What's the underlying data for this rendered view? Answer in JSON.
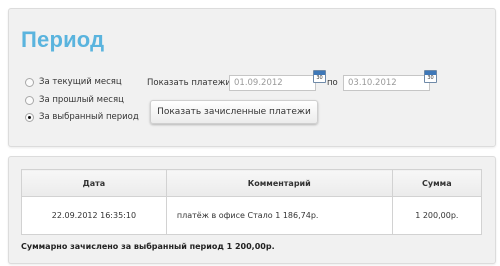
{
  "page": {
    "title": "Период"
  },
  "period_options": [
    {
      "label": "За текущий месяц",
      "checked": false
    },
    {
      "label": "За прошлый месяц",
      "checked": false
    },
    {
      "label": "За выбранный период",
      "checked": true
    }
  ],
  "date_filter": {
    "label_from": "Показать платежи с",
    "from_value": "01.09.2012",
    "label_to": "по",
    "to_value": "03.10.2012",
    "calendar_icon_text": "30"
  },
  "show_button": {
    "label": "Показать зачисленные платежи"
  },
  "table": {
    "headers": [
      "Дата",
      "Комментарий",
      "Сумма"
    ],
    "rows": [
      {
        "date": "22.09.2012 16:35:10",
        "comment": "платёж в офисе Стало 1 186,74р.",
        "amount": "1 200,00р."
      }
    ]
  },
  "summary": {
    "text": "Суммарно зачислено за выбранный период 1 200,00р."
  }
}
